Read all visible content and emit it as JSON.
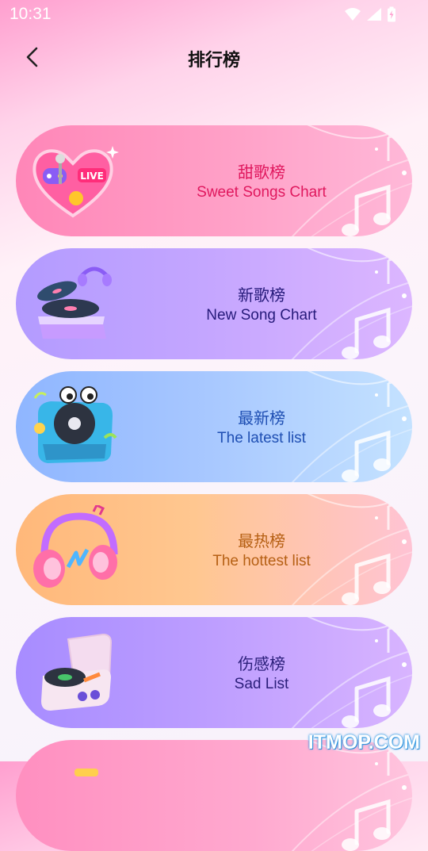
{
  "status_bar": {
    "time": "10:31",
    "icons": [
      "wifi-icon",
      "signal-icon",
      "battery-charging-icon"
    ]
  },
  "header": {
    "title": "排行榜",
    "back_icon": "chevron-left-icon"
  },
  "charts": [
    {
      "zh": "甜歌榜",
      "en": "Sweet Songs Chart",
      "icon": "heart-live-gamepad-icon",
      "color": "#e0185e"
    },
    {
      "zh": "新歌榜",
      "en": "New Song Chart",
      "icon": "turntable-headphones-icon",
      "color": "#261a7a"
    },
    {
      "zh": "最新榜",
      "en": "The latest list",
      "icon": "record-player-eyes-icon",
      "color": "#1f4fb3"
    },
    {
      "zh": "最热榜",
      "en": "The hottest list",
      "icon": "pink-headphones-icon",
      "color": "#b66014"
    },
    {
      "zh": "伤感榜",
      "en": "Sad List",
      "icon": "vinyl-box-icon",
      "color": "#2b1f7a"
    },
    {
      "zh": "",
      "en": "",
      "icon": "chart-icon-partial",
      "color": "#e0185e"
    }
  ],
  "watermark": "ITMOP.COM"
}
